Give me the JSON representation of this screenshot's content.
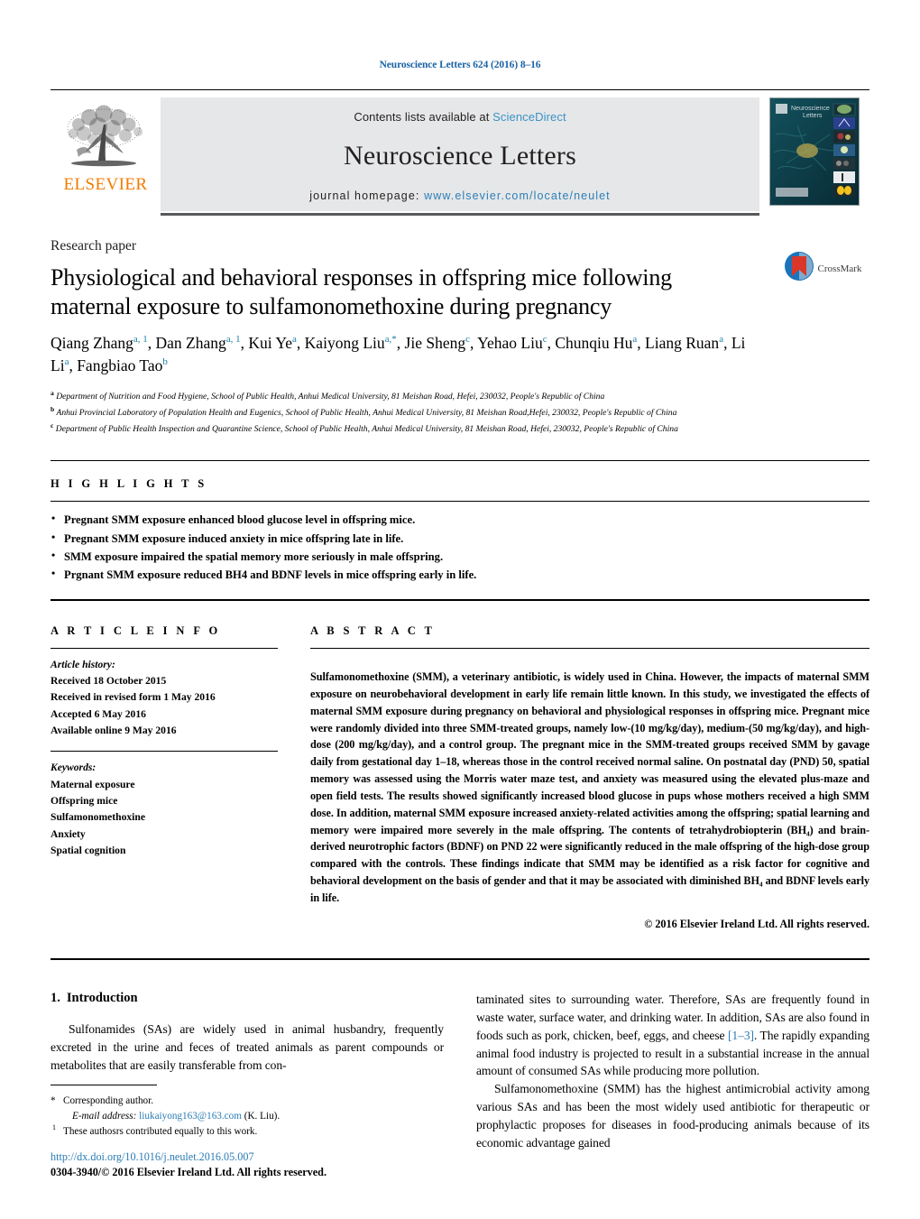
{
  "running_head": "Neuroscience Letters 624 (2016) 8–16",
  "masthead": {
    "publisher_logo_name": "elsevier-tree-logo",
    "publisher_wordmark": "ELSEVIER",
    "contents_prefix": "Contents lists available at ",
    "contents_link": "ScienceDirect",
    "journal_title": "Neuroscience Letters",
    "homepage_prefix": "journal homepage: ",
    "homepage_link": "www.elsevier.com/locate/neulet",
    "cover_title": "Neuroscience Letters"
  },
  "article": {
    "type_label": "Research paper",
    "title": "Physiological and behavioral responses in offspring mice following maternal exposure to sulfamonomethoxine during pregnancy",
    "crossmark_label": "CrossMark",
    "authors": [
      {
        "name": "Qiang Zhang",
        "sup": "a, 1",
        "sep": ", "
      },
      {
        "name": "Dan Zhang",
        "sup": "a, 1",
        "sep": ", "
      },
      {
        "name": "Kui Ye",
        "sup": "a",
        "sep": ", "
      },
      {
        "name": "Kaiyong Liu",
        "sup": "a,*",
        "sep": ", "
      },
      {
        "name": "Jie Sheng",
        "sup": "c",
        "sep": ", "
      },
      {
        "name": "Yehao Liu",
        "sup": "c",
        "sep": ", "
      },
      {
        "name": "Chunqiu Hu",
        "sup": "a",
        "sep": ", "
      },
      {
        "name": "Liang Ruan",
        "sup": "a",
        "sep": ", "
      },
      {
        "name": "Li Li",
        "sup": "a",
        "sep": ", "
      },
      {
        "name": "Fangbiao Tao",
        "sup": "b",
        "sep": ""
      }
    ],
    "affiliations": [
      {
        "mark": "a",
        "text": "Department of Nutrition and Food Hygiene, School of Public Health, Anhui Medical University, 81 Meishan Road, Hefei, 230032, People's Republic of China"
      },
      {
        "mark": "b",
        "text": "Anhui Provincial Laboratory of Population Health and Eugenics, School of Public Health, Anhui Medical University, 81 Meishan Road,Hefei, 230032, People's Republic of China"
      },
      {
        "mark": "c",
        "text": "Department of Public Health Inspection and Quarantine Science, School of Public Health, Anhui Medical University, 81 Meishan Road, Hefei, 230032, People's Republic of China"
      }
    ]
  },
  "highlights": {
    "heading": "H I G H L I G H T S",
    "items": [
      "Pregnant SMM exposure enhanced blood glucose level in offspring mice.",
      "Pregnant SMM exposure induced anxiety in mice offspring late in life.",
      "SMM exposure impaired the spatial memory more seriously in male offspring.",
      "Prgnant SMM exposure reduced BH4 and BDNF levels in mice offspring early in life."
    ]
  },
  "article_info": {
    "heading": "A R T I C L E    I N F O",
    "history_label": "Article history:",
    "history": [
      "Received 18 October 2015",
      "Received in revised form 1 May 2016",
      "Accepted 6 May 2016",
      "Available online 9 May 2016"
    ],
    "keywords_label": "Keywords:",
    "keywords": [
      "Maternal exposure",
      "Offspring mice",
      "Sulfamonomethoxine",
      "Anxiety",
      "Spatial cognition"
    ]
  },
  "abstract": {
    "heading": "A B S T R A C T",
    "text": "Sulfamonomethoxine (SMM), a veterinary antibiotic, is widely used in China. However, the impacts of maternal SMM exposure on neurobehavioral development in early life remain little known. In this study, we investigated the effects of maternal SMM exposure during pregnancy on behavioral and physiological responses in offspring mice. Pregnant mice were randomly divided into three SMM-treated groups, namely low-(10 mg/kg/day), medium-(50 mg/kg/day), and high-dose (200 mg/kg/day), and a control group. The pregnant mice in the SMM-treated groups received SMM by gavage daily from gestational day 1–18, whereas those in the control received normal saline. On postnatal day (PND) 50, spatial memory was assessed using the Morris water maze test, and anxiety was measured using the elevated plus-maze and open field tests. The results showed significantly increased blood glucose in pups whose mothers received a high SMM dose. In addition, maternal SMM exposure increased anxiety-related activities among the offspring; spatial learning and memory were impaired more severely in the male offspring. The contents of tetrahydrobiopterin (BH₄) and brain-derived neurotrophic factors (BDNF) on PND 22 were significantly reduced in the male offspring of the high-dose group compared with the controls. These findings indicate that SMM may be identified as a risk factor for cognitive and behavioral development on the basis of gender and that it may be associated with diminished BH₄ and BDNF levels early in life.",
    "copyright": "© 2016 Elsevier Ireland Ltd. All rights reserved."
  },
  "introduction": {
    "number": "1.",
    "title": "Introduction",
    "paragraph_1_left": "Sulfonamides (SAs) are widely used in animal husbandry, frequently excreted in the urine and feces of treated animals as parent compounds or metabolites that are easily transferable from con-",
    "paragraph_1_right_a": "taminated sites to surrounding water. Therefore, SAs are frequently found in waste water, surface water, and drinking water. In addition, SAs are also found in foods such as pork, chicken, beef, eggs, and cheese ",
    "paragraph_1_ref": "[1–3]",
    "paragraph_1_right_b": ". The rapidly expanding animal food industry is projected to result in a substantial increase in the annual amount of consumed SAs while producing more pollution.",
    "paragraph_2": "Sulfamonomethoxine (SMM) has the highest antimicrobial activity among various SAs and has been the most widely used antibiotic for therapeutic or prophylactic proposes for diseases in food-producing animals because of its economic advantage gained"
  },
  "footnotes": {
    "corresponding_mark": "*",
    "corresponding_text": "Corresponding author.",
    "email_label": "E-mail address:",
    "email": "liukaiyong163@163.com",
    "email_suffix": "(K. Liu).",
    "equal_mark": "1",
    "equal_text": "These authosrs contributed equally to this work."
  },
  "doi": {
    "url": "http://dx.doi.org/10.1016/j.neulet.2016.05.007",
    "issn_line": "0304-3940/© 2016 Elsevier Ireland Ltd. All rights reserved."
  },
  "colors": {
    "link_blue": "#2b7cb5",
    "sciencedirect_blue": "#3a93c6",
    "superscript_blue": "#1a7fa8",
    "elsevier_orange": "#f07c00",
    "banner_grey": "#e6e7e8",
    "cover_teal": "#0d3b46"
  }
}
